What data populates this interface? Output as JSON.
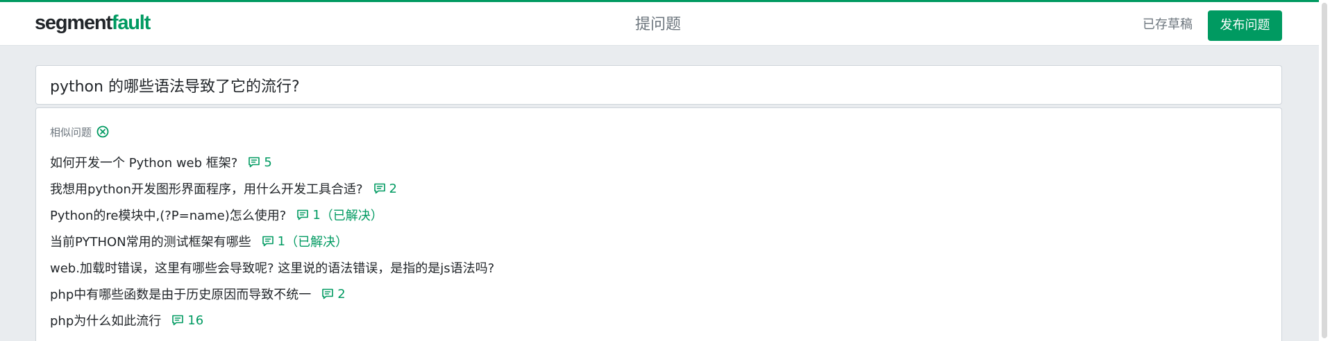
{
  "header": {
    "logo_main": "segment",
    "logo_accent": "fault",
    "page_title": "提问题",
    "draft_status": "已存草稿",
    "publish_label": "发布问题"
  },
  "colors": {
    "brand": "#009a61",
    "muted": "#6c757d",
    "background": "#e9ecef"
  },
  "question": {
    "title_value": "python 的哪些语法导致了它的流行?"
  },
  "similar": {
    "heading": "相似问题",
    "close_icon": "close-circle-icon",
    "items": [
      {
        "title": "如何开发一个 Python web 框架?",
        "answers": "5",
        "status": ""
      },
      {
        "title": "我想用python开发图形界面程序，用什么开发工具合适?",
        "answers": "2",
        "status": ""
      },
      {
        "title": "Python的re模块中,(?P=name)怎么使用?",
        "answers": "1",
        "status": "（已解决）"
      },
      {
        "title": "当前PYTHON常用的测试框架有哪些",
        "answers": "1",
        "status": "（已解决）"
      },
      {
        "title": "web.加载时错误，这里有哪些会导致呢? 这里说的语法错误，是指的是js语法吗?",
        "answers": "",
        "status": ""
      },
      {
        "title": "php中有哪些函数是由于历史原因而导致不统一",
        "answers": "2",
        "status": ""
      },
      {
        "title": "php为什么如此流行",
        "answers": "16",
        "status": ""
      }
    ]
  }
}
